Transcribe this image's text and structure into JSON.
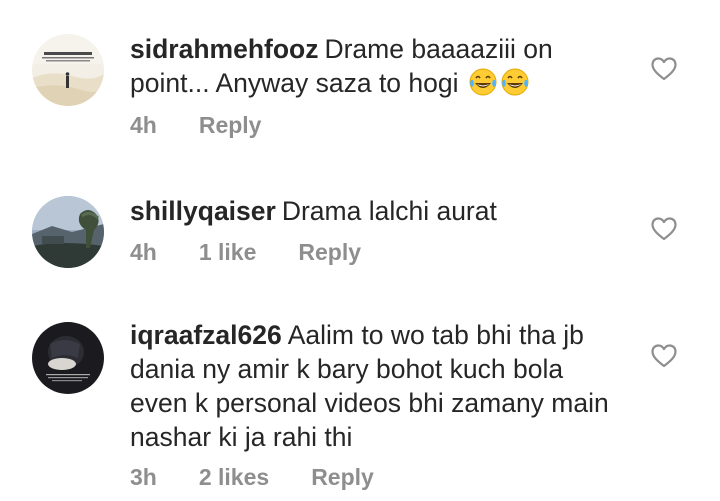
{
  "comments": [
    {
      "username": "sidrahmehfooz",
      "text": "Drame baaaaziii on point... Anyway saza to hogi",
      "emoji": "😂😂",
      "time": "4h",
      "likes": "",
      "reply": "Reply",
      "avatar_icon": "desert-figure-avatar"
    },
    {
      "username": "shillyqaiser",
      "text": "Drama lalchi aurat",
      "time": "4h",
      "likes": "1 like",
      "reply": "Reply",
      "avatar_icon": "landscape-avatar"
    },
    {
      "username": "iqraafzal626",
      "text": "Aalim to wo tab bhi tha jb dania ny amir k bary bohot kuch bola even k personal videos bhi zamany main nashar ki ja rahi thi",
      "time": "3h",
      "likes": "2 likes",
      "reply": "Reply",
      "avatar_icon": "dark-portrait-avatar"
    }
  ],
  "colors": {
    "text": "#262626",
    "muted": "#8e8e8e",
    "background": "#ffffff"
  }
}
